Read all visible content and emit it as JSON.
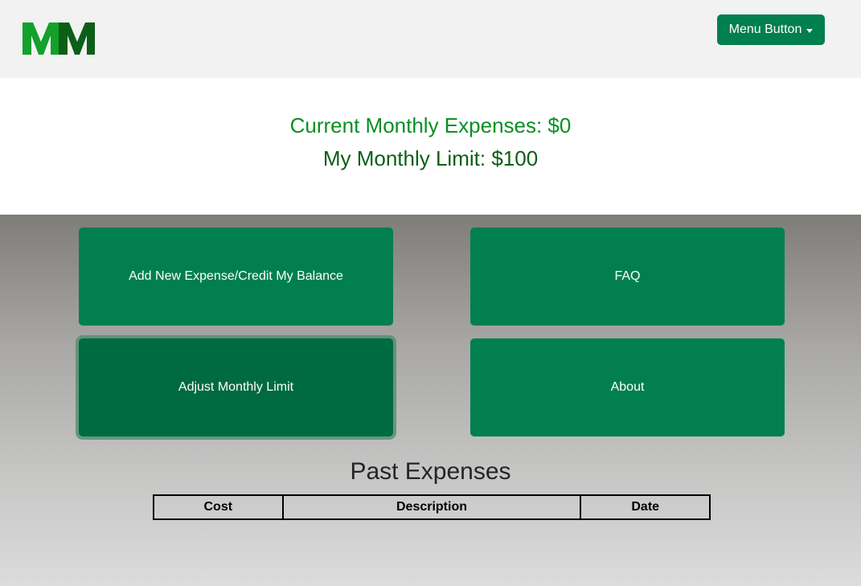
{
  "header": {
    "logo_text": "MM",
    "menu_button_label": "Menu Button"
  },
  "summary": {
    "expenses_label": "Current Monthly Expenses: $0",
    "limit_label": "My Monthly Limit: $100"
  },
  "actions": {
    "add_expense": "Add New Expense/Credit My Balance",
    "faq": "FAQ",
    "adjust_limit": "Adjust Monthly Limit",
    "about": "About"
  },
  "past_expenses": {
    "title": "Past Expenses",
    "columns": [
      "Cost",
      "Description",
      "Date"
    ],
    "rows": []
  },
  "colors": {
    "brand_green": "#017f4f",
    "expenses_text": "#0a8f24",
    "limit_text": "#0b5f17",
    "logo_light": "#13a02b",
    "logo_dark": "#0b5f17"
  },
  "icons": {
    "menu_caret": "caret-down-icon"
  }
}
